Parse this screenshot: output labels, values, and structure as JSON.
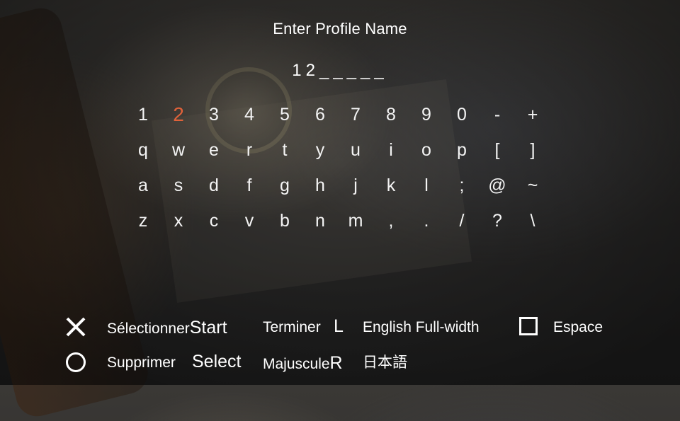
{
  "header": {
    "title": "Enter Profile Name",
    "entry": "12_____"
  },
  "keyboard": {
    "selected": "2",
    "selected_color": "#e0623a",
    "rows": [
      [
        "1",
        "2",
        "3",
        "4",
        "5",
        "6",
        "7",
        "8",
        "9",
        "0",
        "-",
        "+"
      ],
      [
        "q",
        "w",
        "e",
        "r",
        "t",
        "y",
        "u",
        "i",
        "o",
        "p",
        "[",
        "]"
      ],
      [
        "a",
        "s",
        "d",
        "f",
        "g",
        "h",
        "j",
        "k",
        "l",
        ";",
        "@",
        "~"
      ],
      [
        "z",
        "x",
        "c",
        "v",
        "b",
        "n",
        "m",
        ",",
        ".",
        "/",
        "?",
        "\\"
      ]
    ]
  },
  "legend": {
    "select_label": "Sélectionner",
    "start_button": "Start",
    "finish_label": "Terminer",
    "l_button": "L",
    "fullwidth_label": "English Full-width",
    "space_label": "Espace",
    "delete_label": "Supprimer",
    "select_button": "Select",
    "uppercase_label": "Majuscule",
    "r_button": "R",
    "japanese_label": "日本語"
  },
  "icons": {
    "cross": "cross-button-icon",
    "circle": "circle-button-icon",
    "square": "square-button-icon"
  }
}
